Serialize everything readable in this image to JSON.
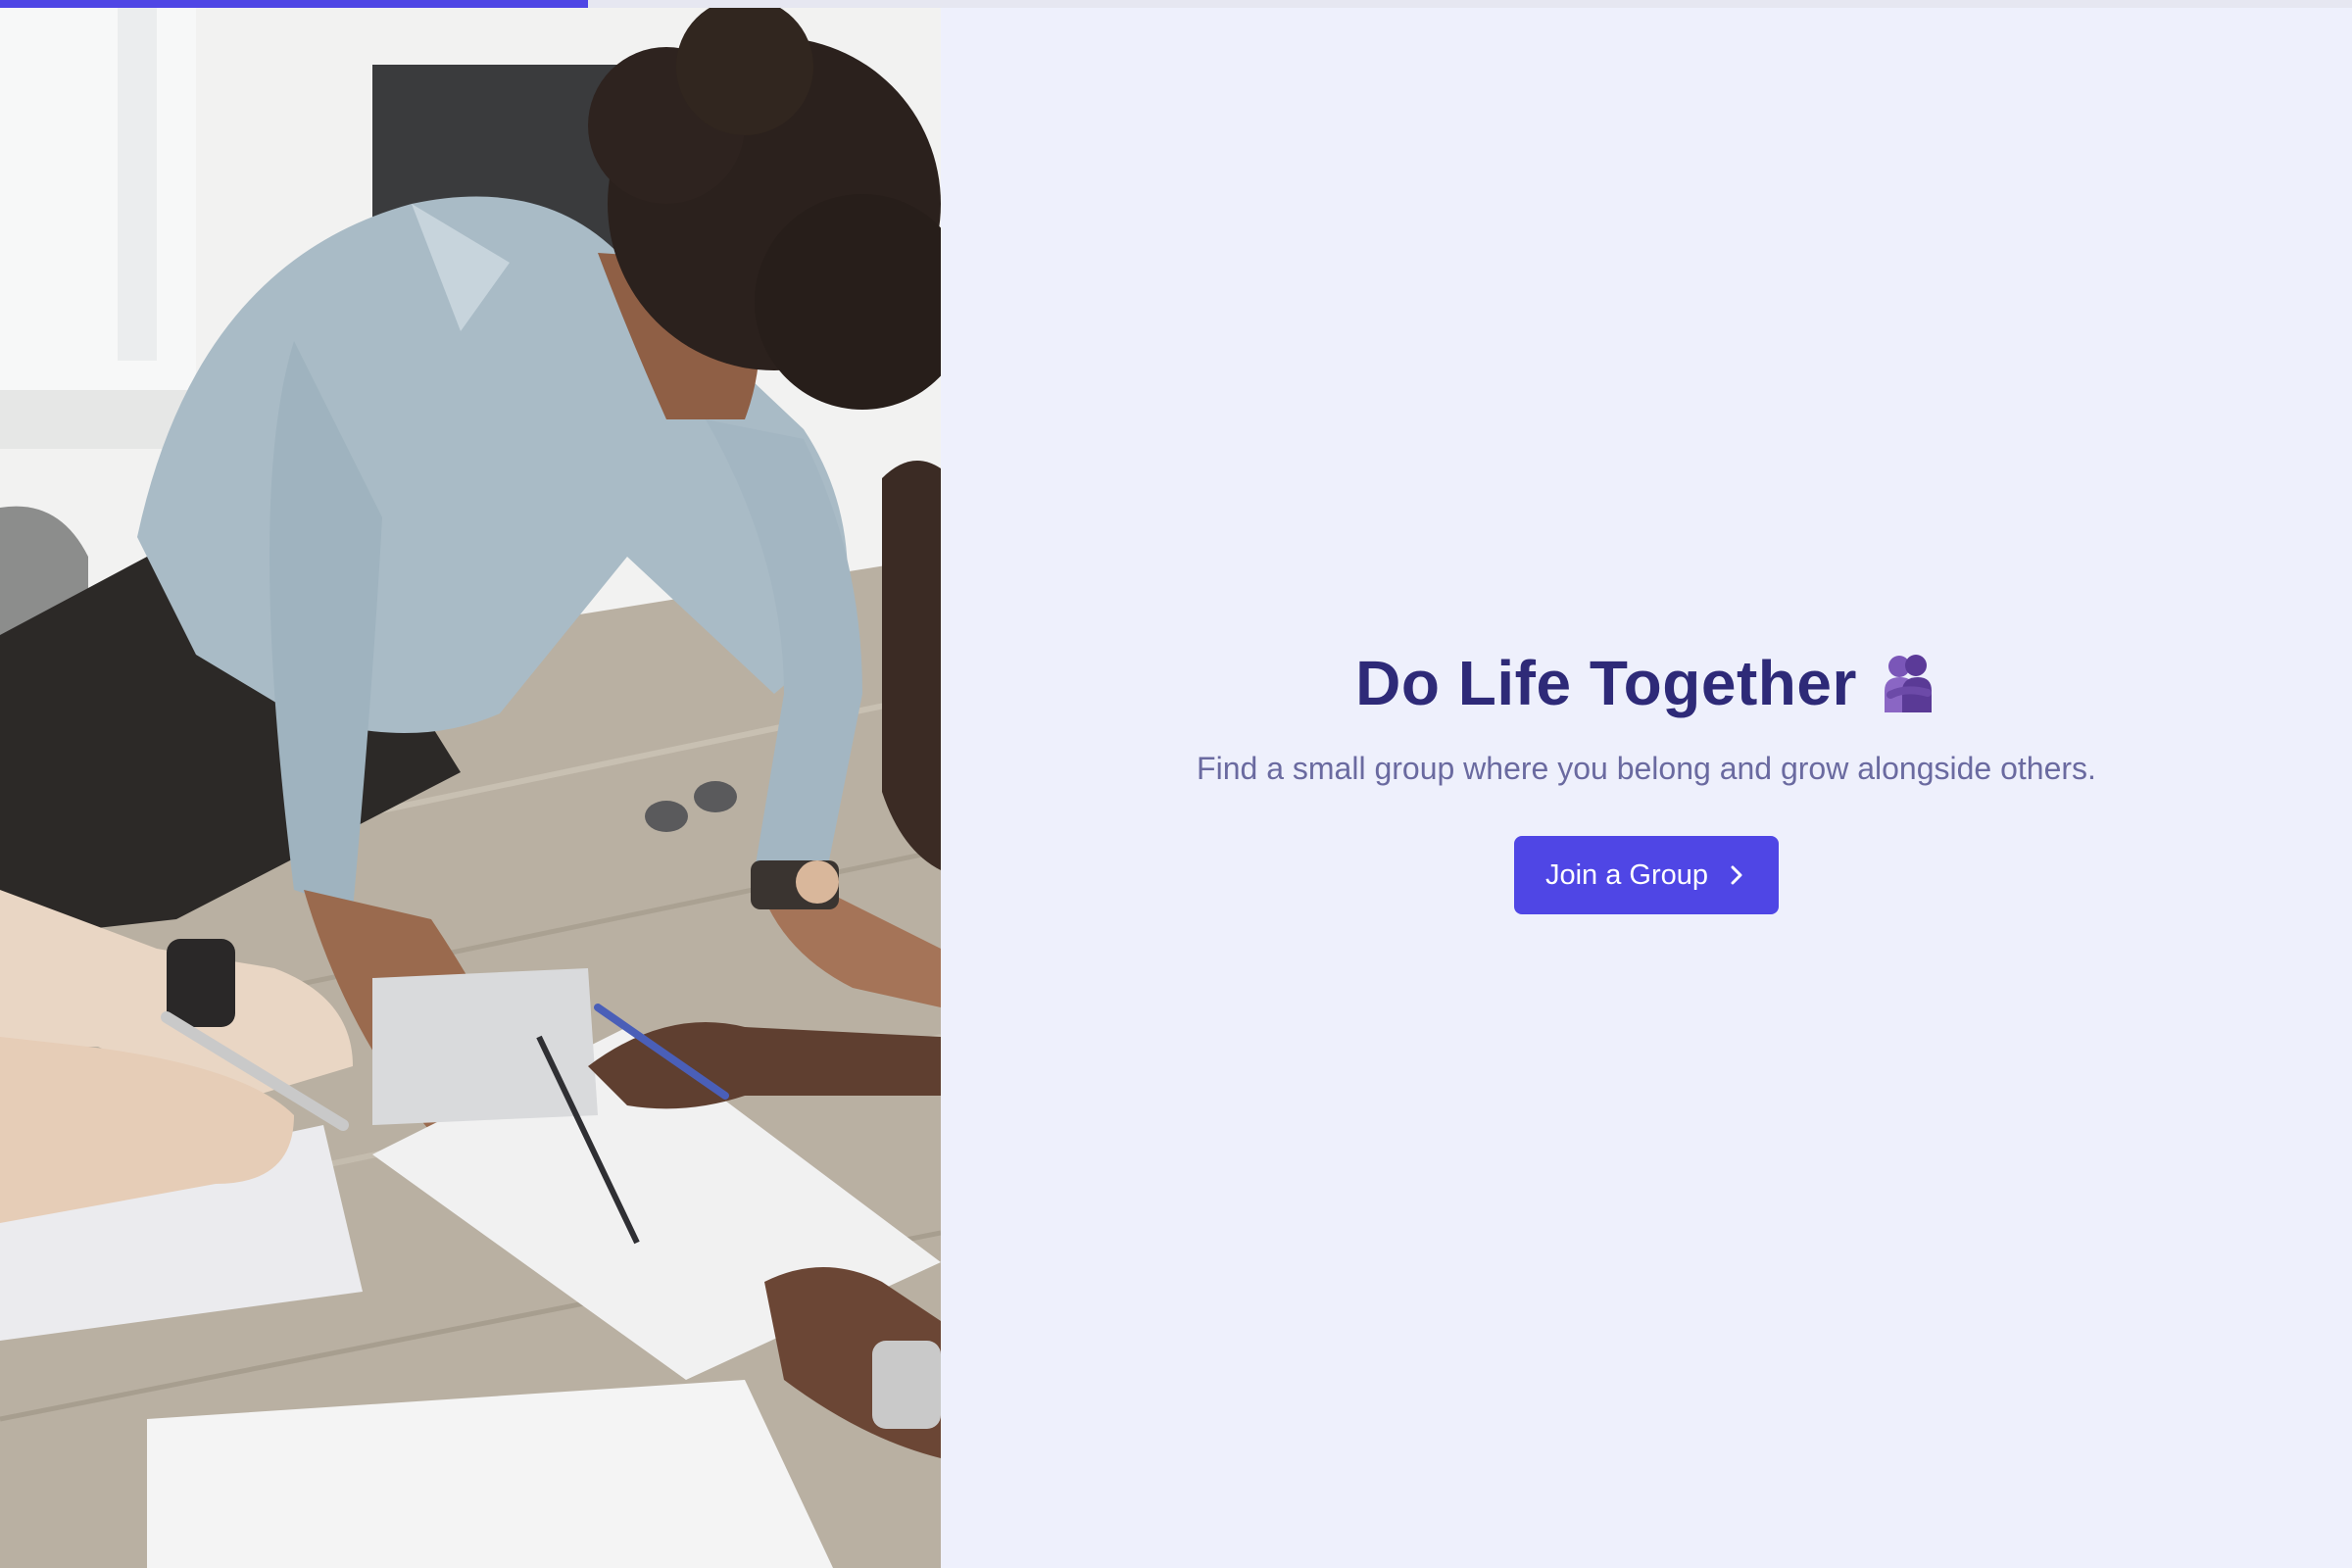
{
  "progress": {
    "value_percent": 25,
    "color": "#4f46e5"
  },
  "photo": {
    "description_icon": "group-study-photo"
  },
  "hero": {
    "title": "Do Life Together",
    "emoji_icon": "people-hugging-icon",
    "subtitle": "Find a small group where you belong and grow alongside others.",
    "cta_label": "Join a Group",
    "cta_icon": "chevron-right-icon"
  },
  "colors": {
    "background": "#eef0fc",
    "title": "#2e2a78",
    "subtitle": "#6a6aa0",
    "accent": "#4f46e5"
  }
}
